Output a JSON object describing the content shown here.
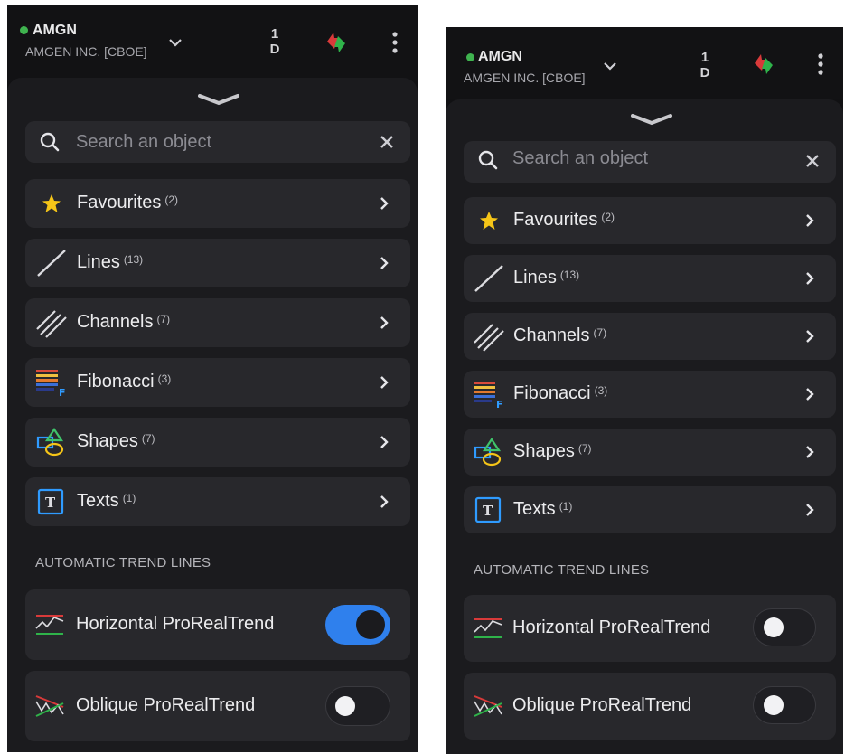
{
  "left": {
    "header": {
      "symbol": "AMGN",
      "instrument": "AMGEN INC. [CBOE]",
      "period_top": "1",
      "period_bottom": "D"
    },
    "search": {
      "placeholder": "Search an object"
    },
    "categories": [
      {
        "label": "Favourites",
        "count": "(2)",
        "icon": "star-icon"
      },
      {
        "label": "Lines",
        "count": "(13)",
        "icon": "line-icon"
      },
      {
        "label": "Channels",
        "count": "(7)",
        "icon": "channels-icon"
      },
      {
        "label": "Fibonacci",
        "count": "(3)",
        "icon": "fibonacci-icon"
      },
      {
        "label": "Shapes",
        "count": "(7)",
        "icon": "shapes-icon"
      },
      {
        "label": "Texts",
        "count": "(1)",
        "icon": "text-icon"
      }
    ],
    "section_title": "AUTOMATIC TREND LINES",
    "trend_rows": [
      {
        "label": "Horizontal ProRealTrend",
        "enabled": true
      },
      {
        "label": "Oblique ProRealTrend",
        "enabled": false
      }
    ]
  },
  "right": {
    "header": {
      "symbol": "AMGN",
      "instrument": "AMGEN INC. [CBOE]",
      "period_top": "1",
      "period_bottom": "D"
    },
    "search": {
      "placeholder": "Search an object"
    },
    "categories": [
      {
        "label": "Favourites",
        "count": "(2)",
        "icon": "star-icon"
      },
      {
        "label": "Lines",
        "count": "(13)",
        "icon": "line-icon"
      },
      {
        "label": "Channels",
        "count": "(7)",
        "icon": "channels-icon"
      },
      {
        "label": "Fibonacci",
        "count": "(3)",
        "icon": "fibonacci-icon"
      },
      {
        "label": "Shapes",
        "count": "(7)",
        "icon": "shapes-icon"
      },
      {
        "label": "Texts",
        "count": "(1)",
        "icon": "text-icon"
      }
    ],
    "section_title": "AUTOMATIC TREND LINES",
    "trend_rows": [
      {
        "label": "Horizontal ProRealTrend",
        "enabled": false
      },
      {
        "label": "Oblique ProRealTrend",
        "enabled": false
      }
    ]
  },
  "colors": {
    "toggle_on": "#2f80ed",
    "status_dot": "#3fb34f",
    "star": "#f5c518"
  }
}
